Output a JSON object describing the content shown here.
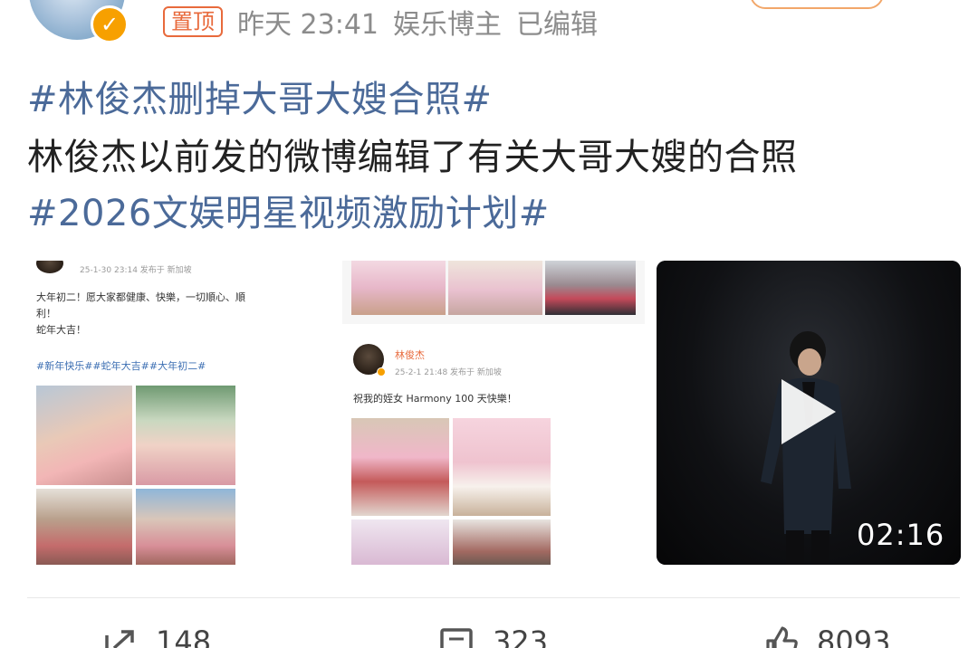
{
  "header": {
    "pin_label": "置顶",
    "time": "昨天 23:41",
    "author_type": "娱乐博主",
    "edited": "已编辑"
  },
  "post": {
    "hashtag_title": "#林俊杰删掉大哥大嫂合照#",
    "body": "林俊杰以前发的微博编辑了有关大哥大嫂的合照",
    "hashtag_campaign": "#2026文娱明星视频激励计划#"
  },
  "media": {
    "shot1": {
      "meta": "25-1-30 23:14  发布于 新加坡",
      "line1": "大年初二！愿大家都健康、快樂，一切順心、順",
      "line2": "利！",
      "line3": "蛇年大吉！",
      "tags": "#新年快乐##蛇年大吉##大年初二#"
    },
    "shot2": {
      "author": "林俊杰",
      "meta": "25-2-1 21:48  发布于 新加坡",
      "text": "祝我的姪女 Harmony 100 天快樂！"
    },
    "video": {
      "duration": "02:16"
    }
  },
  "actions": {
    "repost_count": "148",
    "comment_count": "323",
    "like_count": "8093"
  },
  "colors": {
    "hashtag": "#4b6a99",
    "pin": "#e86a3c",
    "verified": "#f7a000"
  }
}
